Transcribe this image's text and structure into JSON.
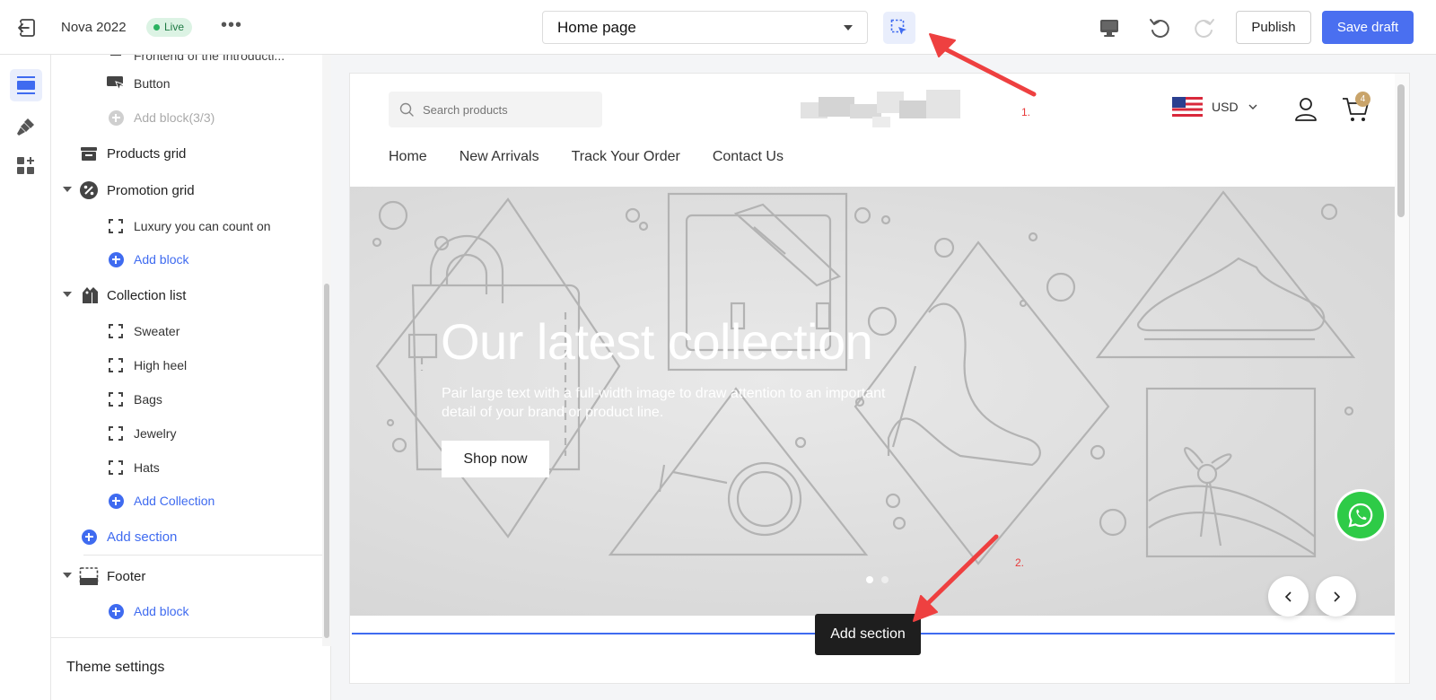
{
  "topbar": {
    "store_name": "Nova 2022",
    "live_label": "Live",
    "page_selector": "Home page",
    "publish_label": "Publish",
    "save_draft_label": "Save draft",
    "accent_color": "#4a6ff0"
  },
  "rail": {
    "items": [
      {
        "icon": "sections-icon",
        "active": true
      },
      {
        "icon": "theme-style-icon",
        "active": false
      },
      {
        "icon": "apps-icon",
        "active": false
      }
    ]
  },
  "sidebar": {
    "truncated_item": "Frontend of the Introducti...",
    "items": {
      "button": "Button",
      "add_block_limit": "Add block(3/3)",
      "products_grid": "Products grid",
      "promotion_grid": "Promotion grid",
      "luxury": "Luxury you can count on",
      "add_block_1": "Add block",
      "collection_list": "Collection list",
      "sweater": "Sweater",
      "high_heel": "High heel",
      "bags": "Bags",
      "jewelry": "Jewelry",
      "hats": "Hats",
      "add_collection": "Add Collection",
      "add_section": "Add section",
      "footer": "Footer",
      "add_block_2": "Add block"
    },
    "theme_settings": "Theme settings"
  },
  "preview": {
    "search_placeholder": "Search products",
    "currency": "USD",
    "cart_count": "4",
    "nav": [
      "Home",
      "New Arrivals",
      "Track Your Order",
      "Contact Us"
    ],
    "hero": {
      "title": "Our latest collection",
      "text": "Pair large text with a full-width image to draw attention to an important detail of your brand or product line.",
      "button": "Shop now"
    },
    "add_section_tooltip": "Add section"
  },
  "annotations": {
    "one": "1.",
    "two": "2.",
    "color": "#e83a3a"
  }
}
